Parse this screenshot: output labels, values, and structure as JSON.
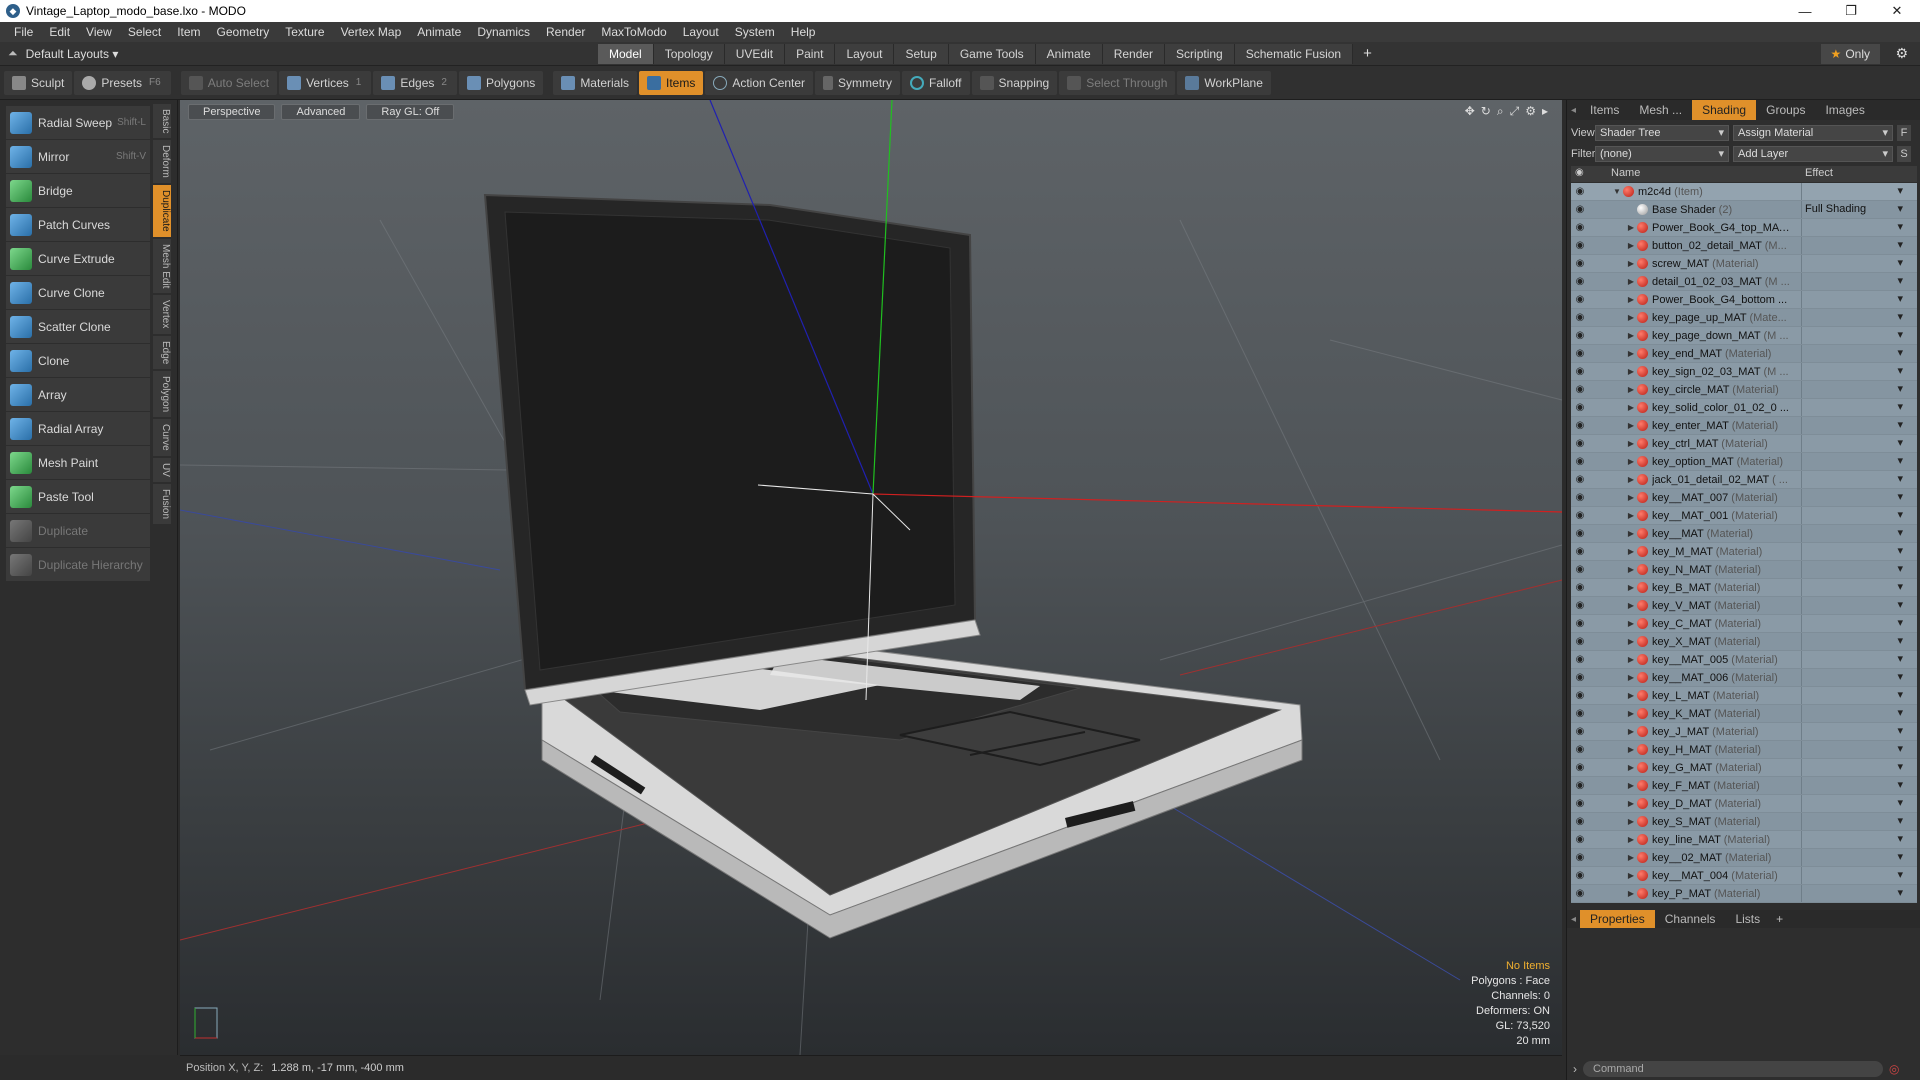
{
  "window": {
    "title": "Vintage_Laptop_modo_base.lxo - MODO",
    "minimize": "—",
    "maximize": "❐",
    "close": "✕"
  },
  "menu": [
    "File",
    "Edit",
    "View",
    "Select",
    "Item",
    "Geometry",
    "Texture",
    "Vertex Map",
    "Animate",
    "Dynamics",
    "Render",
    "MaxToModo",
    "Layout",
    "System",
    "Help"
  ],
  "layoutbar": {
    "layout_label": "Default Layouts ▾",
    "tabs": [
      "Model",
      "Topology",
      "UVEdit",
      "Paint",
      "Layout",
      "Setup",
      "Game Tools",
      "Animate",
      "Render",
      "Scripting",
      "Schematic Fusion"
    ],
    "active_tab": "Model",
    "plus": "+",
    "only_star": "★",
    "only_label": "Only"
  },
  "toolbar": {
    "sculpt": "Sculpt",
    "presets": "Presets",
    "presets_key": "F6",
    "auto_select": "Auto Select",
    "vertices": "Vertices",
    "vertices_count": "1",
    "edges": "Edges",
    "edges_count": "2",
    "polygons": "Polygons",
    "materials": "Materials",
    "items": "Items",
    "action_center": "Action Center",
    "symmetry": "Symmetry",
    "falloff": "Falloff",
    "snapping": "Snapping",
    "select_through": "Select Through",
    "workplane": "WorkPlane"
  },
  "tools": [
    {
      "label": "Radial Sweep",
      "shortcut": "Shift-L"
    },
    {
      "label": "Mirror",
      "shortcut": "Shift-V"
    },
    {
      "label": "Bridge",
      "shortcut": ""
    },
    {
      "label": "Patch Curves",
      "shortcut": ""
    },
    {
      "label": "Curve Extrude",
      "shortcut": ""
    },
    {
      "label": "Curve Clone",
      "shortcut": ""
    },
    {
      "label": "Scatter Clone",
      "shortcut": ""
    },
    {
      "label": "Clone",
      "shortcut": ""
    },
    {
      "label": "Array",
      "shortcut": ""
    },
    {
      "label": "Radial Array",
      "shortcut": ""
    },
    {
      "label": "Mesh Paint",
      "shortcut": ""
    },
    {
      "label": "Paste Tool",
      "shortcut": ""
    },
    {
      "label": "Duplicate",
      "shortcut": ""
    },
    {
      "label": "Duplicate Hierarchy",
      "shortcut": ""
    }
  ],
  "vtabs": [
    "Basic",
    "Deform",
    "Duplicate",
    "Mesh Edit",
    "Vertex",
    "Edge",
    "Polygon",
    "Curve",
    "UV",
    "Fusion"
  ],
  "viewport": {
    "view_mode": "Perspective",
    "shading": "Advanced",
    "raygl": "Ray GL: Off",
    "info": {
      "items": "No Items",
      "polygons": "Polygons : Face",
      "channels": "Channels: 0",
      "deformers": "Deformers: ON",
      "gl": "GL: 73,520",
      "scale": "20 mm"
    }
  },
  "status": {
    "label": "Position X, Y, Z:",
    "value": "1.288 m, -17 mm, -400 mm"
  },
  "right_panel": {
    "tabs": [
      "Items",
      "Mesh ...",
      "Shading",
      "Groups",
      "Images"
    ],
    "active_tab": "Shading",
    "view_label": "View",
    "view_value": "Shader Tree",
    "assign_material": "Assign Material",
    "filter_label": "Filter",
    "filter_value": "(none)",
    "add_layer": "Add Layer",
    "col_name": "Name",
    "col_effect": "Effect",
    "tree": [
      {
        "name": "m2c4d",
        "type": "(Item)",
        "effect": "",
        "kind": "root"
      },
      {
        "name": "Base Shader",
        "type": "(2)",
        "effect": "Full Shading",
        "kind": "shader"
      },
      {
        "name": "Power_Book_G4_top_MA ...",
        "type": "",
        "effect": "",
        "kind": "mat"
      },
      {
        "name": "button_02_detail_MAT",
        "type": "(M...",
        "effect": "",
        "kind": "mat"
      },
      {
        "name": "screw_MAT",
        "type": "(Material)",
        "effect": "",
        "kind": "mat"
      },
      {
        "name": "detail_01_02_03_MAT",
        "type": "(M ...",
        "effect": "",
        "kind": "mat"
      },
      {
        "name": "Power_Book_G4_bottom ...",
        "type": "",
        "effect": "",
        "kind": "mat"
      },
      {
        "name": "key_page_up_MAT",
        "type": "(Mate...",
        "effect": "",
        "kind": "mat"
      },
      {
        "name": "key_page_down_MAT",
        "type": "(M ...",
        "effect": "",
        "kind": "mat"
      },
      {
        "name": "key_end_MAT",
        "type": "(Material)",
        "effect": "",
        "kind": "mat"
      },
      {
        "name": "key_sign_02_03_MAT",
        "type": "(M ...",
        "effect": "",
        "kind": "mat"
      },
      {
        "name": "key_circle_MAT",
        "type": "(Material)",
        "effect": "",
        "kind": "mat"
      },
      {
        "name": "key_solid_color_01_02_0 ...",
        "type": "",
        "effect": "",
        "kind": "mat"
      },
      {
        "name": "key_enter_MAT",
        "type": "(Material)",
        "effect": "",
        "kind": "mat"
      },
      {
        "name": "key_ctrl_MAT",
        "type": "(Material)",
        "effect": "",
        "kind": "mat"
      },
      {
        "name": "key_option_MAT",
        "type": "(Material)",
        "effect": "",
        "kind": "mat"
      },
      {
        "name": "jack_01_detail_02_MAT",
        "type": "( ...",
        "effect": "",
        "kind": "mat"
      },
      {
        "name": "key__MAT_007",
        "type": "(Material)",
        "effect": "",
        "kind": "mat"
      },
      {
        "name": "key__MAT_001",
        "type": "(Material)",
        "effect": "",
        "kind": "mat"
      },
      {
        "name": "key__MAT",
        "type": "(Material)",
        "effect": "",
        "kind": "mat"
      },
      {
        "name": "key_M_MAT",
        "type": "(Material)",
        "effect": "",
        "kind": "mat"
      },
      {
        "name": "key_N_MAT",
        "type": "(Material)",
        "effect": "",
        "kind": "mat"
      },
      {
        "name": "key_B_MAT",
        "type": "(Material)",
        "effect": "",
        "kind": "mat"
      },
      {
        "name": "key_V_MAT",
        "type": "(Material)",
        "effect": "",
        "kind": "mat"
      },
      {
        "name": "key_C_MAT",
        "type": "(Material)",
        "effect": "",
        "kind": "mat"
      },
      {
        "name": "key_X_MAT",
        "type": "(Material)",
        "effect": "",
        "kind": "mat"
      },
      {
        "name": "key__MAT_005",
        "type": "(Material)",
        "effect": "",
        "kind": "mat"
      },
      {
        "name": "key__MAT_006",
        "type": "(Material)",
        "effect": "",
        "kind": "mat"
      },
      {
        "name": "key_L_MAT",
        "type": "(Material)",
        "effect": "",
        "kind": "mat"
      },
      {
        "name": "key_K_MAT",
        "type": "(Material)",
        "effect": "",
        "kind": "mat"
      },
      {
        "name": "key_J_MAT",
        "type": "(Material)",
        "effect": "",
        "kind": "mat"
      },
      {
        "name": "key_H_MAT",
        "type": "(Material)",
        "effect": "",
        "kind": "mat"
      },
      {
        "name": "key_G_MAT",
        "type": "(Material)",
        "effect": "",
        "kind": "mat"
      },
      {
        "name": "key_F_MAT",
        "type": "(Material)",
        "effect": "",
        "kind": "mat"
      },
      {
        "name": "key_D_MAT",
        "type": "(Material)",
        "effect": "",
        "kind": "mat"
      },
      {
        "name": "key_S_MAT",
        "type": "(Material)",
        "effect": "",
        "kind": "mat"
      },
      {
        "name": "key_line_MAT",
        "type": "(Material)",
        "effect": "",
        "kind": "mat"
      },
      {
        "name": "key__02_MAT",
        "type": "(Material)",
        "effect": "",
        "kind": "mat"
      },
      {
        "name": "key__MAT_004",
        "type": "(Material)",
        "effect": "",
        "kind": "mat"
      },
      {
        "name": "key_P_MAT",
        "type": "(Material)",
        "effect": "",
        "kind": "mat"
      }
    ],
    "bottom_tabs": [
      "Properties",
      "Channels",
      "Lists"
    ],
    "bottom_active": "Properties",
    "command_placeholder": "Command"
  },
  "colors": {
    "accent": "#e0902a",
    "axis_x": "#d02020",
    "axis_y": "#20c020",
    "axis_z": "#2030c0"
  }
}
